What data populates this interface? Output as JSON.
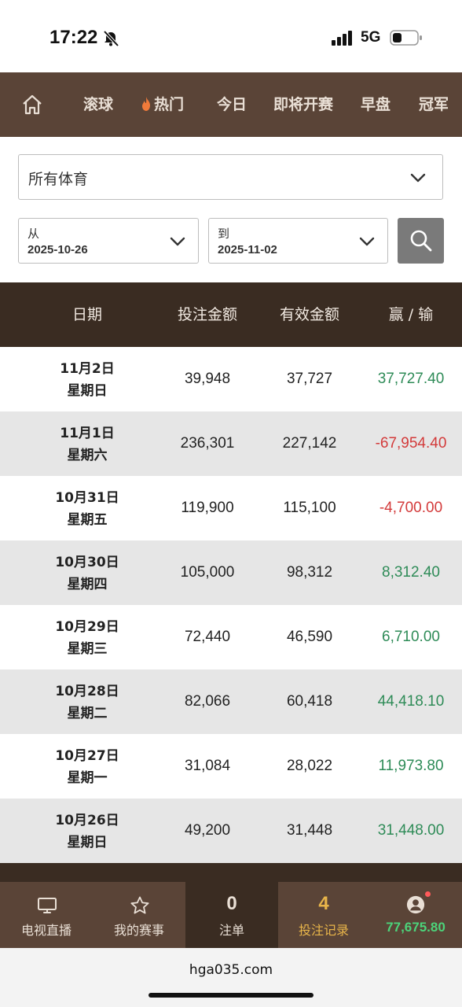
{
  "status_bar": {
    "time": "17:22",
    "network": "5G"
  },
  "nav": {
    "items": [
      {
        "label": "滚球"
      },
      {
        "label": "热门"
      },
      {
        "label": "今日"
      },
      {
        "label": "即将开赛"
      },
      {
        "label": "早盘"
      },
      {
        "label": "冠军"
      }
    ]
  },
  "filters": {
    "sport": "所有体育",
    "from_label": "从",
    "from_date": "2025-10-26",
    "to_label": "到",
    "to_date": "2025-11-02"
  },
  "table": {
    "headers": [
      "日期",
      "投注金额",
      "有效金额",
      "赢 / 输"
    ],
    "rows": [
      {
        "date": "11月2日",
        "weekday": "星期日",
        "bet": "39,948",
        "valid": "37,727",
        "winloss": "37,727.40",
        "sign": "pos"
      },
      {
        "date": "11月1日",
        "weekday": "星期六",
        "bet": "236,301",
        "valid": "227,142",
        "winloss": "-67,954.40",
        "sign": "neg"
      },
      {
        "date": "10月31日",
        "weekday": "星期五",
        "bet": "119,900",
        "valid": "115,100",
        "winloss": "-4,700.00",
        "sign": "neg"
      },
      {
        "date": "10月30日",
        "weekday": "星期四",
        "bet": "105,000",
        "valid": "98,312",
        "winloss": "8,312.40",
        "sign": "pos"
      },
      {
        "date": "10月29日",
        "weekday": "星期三",
        "bet": "72,440",
        "valid": "46,590",
        "winloss": "6,710.00",
        "sign": "pos"
      },
      {
        "date": "10月28日",
        "weekday": "星期二",
        "bet": "82,066",
        "valid": "60,418",
        "winloss": "44,418.10",
        "sign": "pos"
      },
      {
        "date": "10月27日",
        "weekday": "星期一",
        "bet": "31,084",
        "valid": "28,022",
        "winloss": "11,973.80",
        "sign": "pos"
      },
      {
        "date": "10月26日",
        "weekday": "星期日",
        "bet": "49,200",
        "valid": "31,448",
        "winloss": "31,448.00",
        "sign": "pos"
      }
    ]
  },
  "bottom_nav": {
    "tv_label": "电视直播",
    "my_events_label": "我的赛事",
    "bets_count": "0",
    "bets_label": "注单",
    "history_count": "4",
    "history_label": "投注记录",
    "balance": "77,675.80"
  },
  "browser": {
    "url": "hga035.com"
  },
  "colors": {
    "nav_bg": "#5a4437",
    "header_bg": "#3a2c22",
    "positive": "#2e8b57",
    "negative": "#d33a3a",
    "accent_gold": "#e8b54a",
    "balance_green": "#4cd37a"
  }
}
